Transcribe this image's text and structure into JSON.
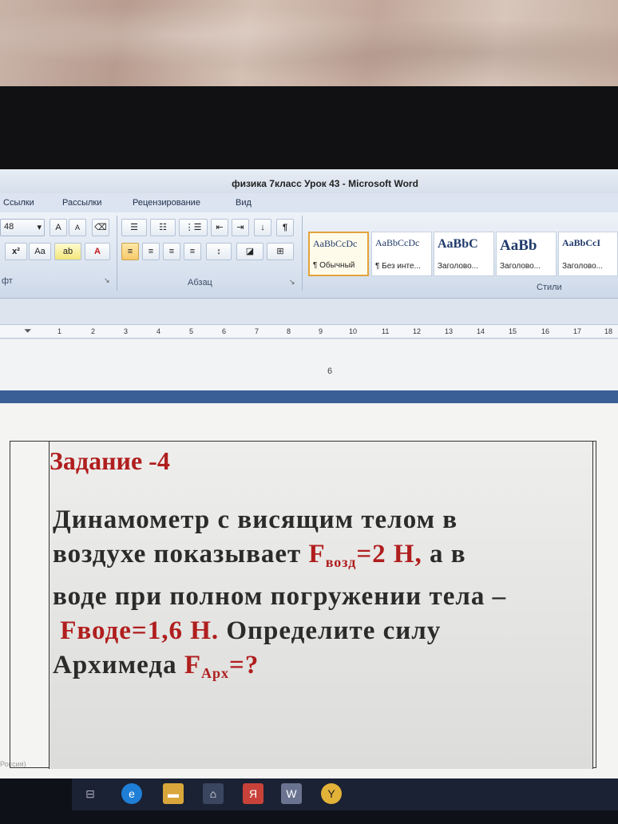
{
  "window": {
    "title": "физика  7класс  Урок 43 - Microsoft Word"
  },
  "ribbon_tabs": [
    {
      "label": "Ссылки"
    },
    {
      "label": "Рассылки"
    },
    {
      "label": "Рецензирование"
    },
    {
      "label": "Вид"
    }
  ],
  "font_group": {
    "font_size": "48",
    "label": "фт"
  },
  "paragraph_group": {
    "label": "Абзац"
  },
  "styles_group": {
    "label": "Стили",
    "styles": [
      {
        "sample": "AaBbCcDc",
        "name": "¶ Обычный"
      },
      {
        "sample": "AaBbCcDc",
        "name": "¶ Без инте..."
      },
      {
        "sample": "AaBbC",
        "name": "Заголово..."
      },
      {
        "sample": "AaBb",
        "name": "Заголово..."
      },
      {
        "sample": "AaBbCcI",
        "name": "Заголово..."
      }
    ]
  },
  "ruler": {
    "marks": [
      "1",
      "2",
      "3",
      "4",
      "5",
      "6",
      "7",
      "8",
      "9",
      "10",
      "11",
      "12",
      "13",
      "14",
      "15",
      "16",
      "17",
      "18"
    ]
  },
  "document": {
    "page_number": "6",
    "task_title": "Задание -4",
    "line1": "Динамометр с висящим телом в",
    "line2_a": "воздухе показывает ",
    "line2_F": "F",
    "line2_sub": "возд",
    "line2_val": "=2 Н,",
    "line2_b": " а в",
    "line3": "воде при полном погружении тела –",
    "line4_red": "Fводе=1,6 Н.",
    "line4_b": " Определите силу",
    "line5_a": "Архимеда ",
    "line5_F": "F",
    "line5_sub": "Арх",
    "line5_val": "=?"
  },
  "statusbar": {
    "language": "Россия)"
  },
  "colors": {
    "accent_red": "#b01e1e",
    "page_break": "#3a5f96"
  }
}
